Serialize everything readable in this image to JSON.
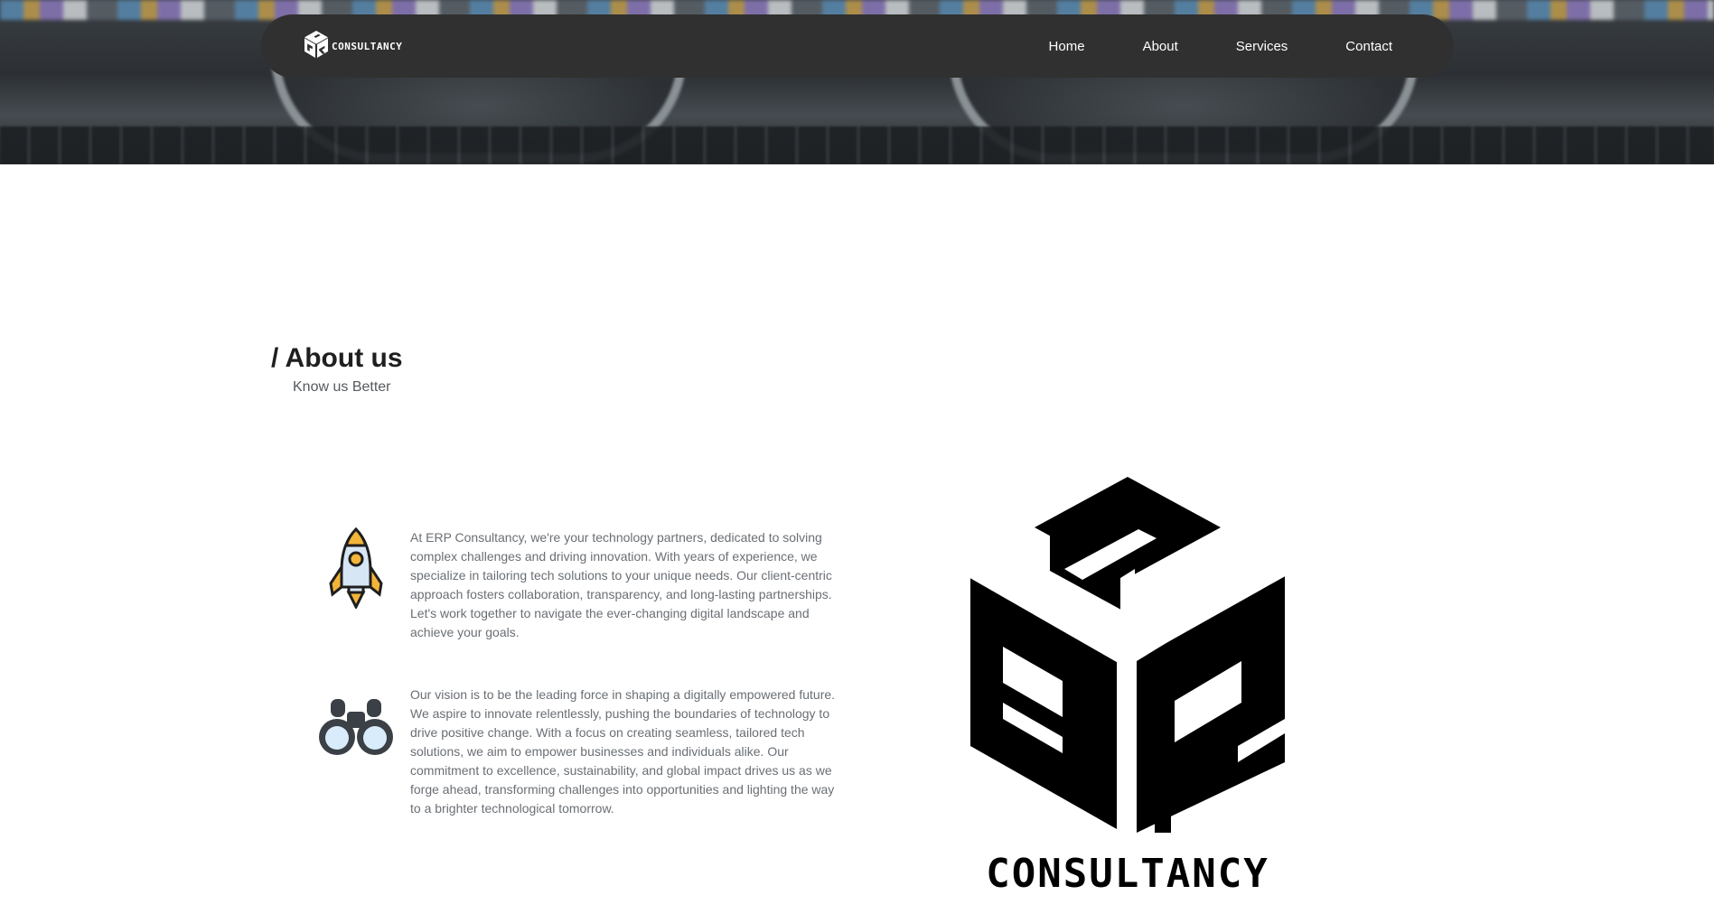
{
  "nav": {
    "brand": "CONSULTANCY",
    "links": [
      {
        "label": "Home"
      },
      {
        "label": "About"
      },
      {
        "label": "Services"
      },
      {
        "label": "Contact"
      }
    ]
  },
  "about": {
    "title": "/ About us",
    "subtitle": "Know us Better",
    "features": [
      {
        "icon": "rocket-icon",
        "text": "At ERP Consultancy, we're your technology partners, dedicated to solving complex challenges and driving innovation. With years of experience, we specialize in tailoring tech solutions to your unique needs. Our client-centric approach fosters collaboration, transparency, and long-lasting partnerships. Let's work together to navigate the ever-changing digital landscape and achieve your goals."
      },
      {
        "icon": "binoculars-icon",
        "text": "Our vision is to be the leading force in shaping a digitally empowered future. We aspire to innovate relentlessly, pushing the boundaries of technology to drive positive change. With a focus on creating seamless, tailored tech solutions, we aim to empower businesses and individuals alike. Our commitment to excellence, sustainability, and global impact drives us as we forge ahead, transforming challenges into opportunities and lighting the way to a brighter technological tomorrow."
      }
    ]
  },
  "logo": {
    "wordmark": "CONSULTANCY"
  },
  "colors": {
    "nav_bg": "#303030",
    "title": "#1f1f1f",
    "body_text": "#6a6f74",
    "rocket_accent": "#f2b53a",
    "rocket_body": "#d6e6f5",
    "binocular_body": "#3b4046",
    "binocular_lens": "#d8ecfb"
  }
}
